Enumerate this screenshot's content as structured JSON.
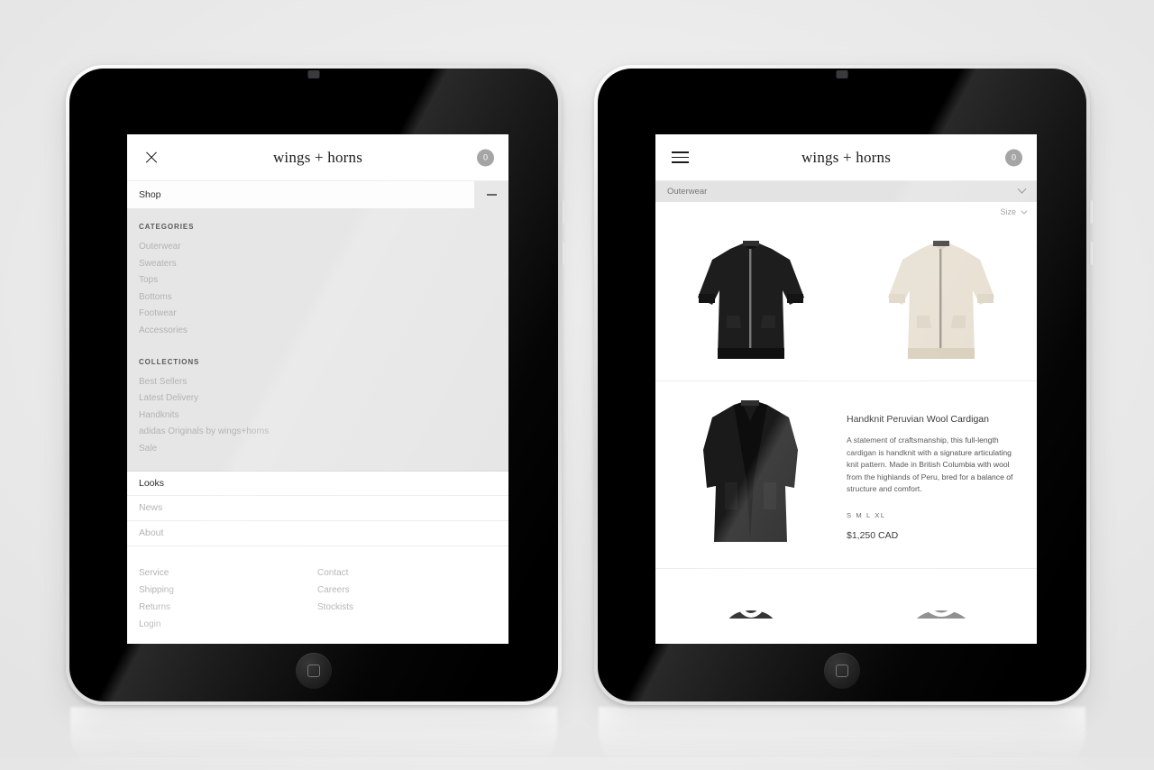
{
  "brand": "wings + horns",
  "left_device": {
    "header": {
      "close_icon": "close-icon",
      "brand": "wings + horns",
      "cart_count": "0"
    },
    "nav": {
      "shop_label": "Shop",
      "collapse_icon": "minus-icon",
      "categories_heading": "CATEGORIES",
      "categories": [
        "Outerwear",
        "Sweaters",
        "Tops",
        "Bottoms",
        "Footwear",
        "Accessories"
      ],
      "collections_heading": "COLLECTIONS",
      "collections": [
        "Best Sellers",
        "Latest Delivery",
        "Handknits",
        "adidas Originals by wings+horns",
        "Sale"
      ],
      "primary_rows": [
        "Looks",
        "News",
        "About"
      ]
    },
    "footer": {
      "column_one": [
        "Service",
        "Shipping",
        "Returns",
        "Login"
      ],
      "column_two": [
        "Contact",
        "Careers",
        "Stockists"
      ]
    }
  },
  "right_device": {
    "header": {
      "menu_icon": "hamburger-icon",
      "brand": "wings + horns",
      "cart_count": "0"
    },
    "filters": {
      "category": "Outerwear",
      "category_chevron": "chevron-down-icon",
      "size": "Size",
      "size_chevron": "chevron-down-icon"
    },
    "grid_products": [
      {
        "name": "Black Knit Zip Cardigan",
        "color": "#1b1b1b"
      },
      {
        "name": "Cream Knit Zip Cardigan",
        "color": "#e4ddcb"
      }
    ],
    "featured_product": {
      "image_name": "long-black-cardigan",
      "title": "Handknit Peruvian Wool Cardigan",
      "description": "A statement of craftsmanship, this full-length cardigan is handknit with a signature articulating knit pattern. Made in British Columbia with wool from the highlands of Peru, bred for a balance of structure and comfort.",
      "sizes": "S M L XL",
      "price": "$1,250 CAD"
    },
    "next_row_products": [
      {
        "name": "Black Garment",
        "color": "#1c1c1c"
      },
      {
        "name": "Grey Garment",
        "color": "#8d8d8d"
      }
    ]
  }
}
